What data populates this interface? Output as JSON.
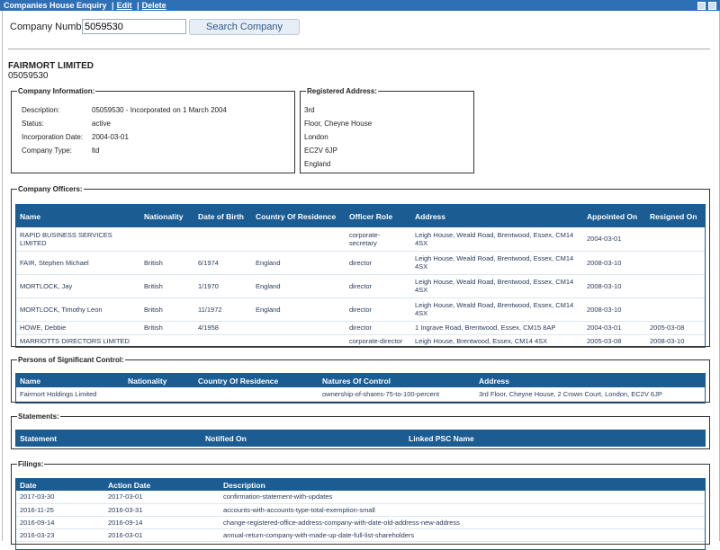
{
  "window": {
    "title": "Companies House Enquiry",
    "sep1": "|",
    "edit": "Edit",
    "sep2": "|",
    "delete": "Delete"
  },
  "search": {
    "label": "Company Number:",
    "value": "5059530",
    "button": "Search Company"
  },
  "company": {
    "name": "FAIRMORT LIMITED",
    "number": "05059530"
  },
  "info": {
    "legend": "Company Information:",
    "rows": [
      {
        "k": "Description:",
        "v": "05059530 - Incorporated on 1 March 2004"
      },
      {
        "k": "Status:",
        "v": "active"
      },
      {
        "k": "Incorporation Date:",
        "v": "2004-03-01"
      },
      {
        "k": "Company Type:",
        "v": "ltd"
      }
    ]
  },
  "address": {
    "legend": "Registered Address:",
    "lines": [
      "3rd",
      "Floor, Cheyne House",
      "London",
      "EC2V 6JP",
      "England"
    ]
  },
  "officers": {
    "legend": "Company Officers:",
    "headers": [
      "Name",
      "Nationality",
      "Date of Birth",
      "Country Of Residence",
      "Officer Role",
      "Address",
      "Appointed On",
      "Resigned On"
    ],
    "rows": [
      [
        "RAPID BUSINESS SERVICES LIMITED",
        "",
        "",
        "",
        "corporate-secretary",
        "Leigh House, Weald Road, Brentwood, Essex, CM14 4SX",
        "2004-03-01",
        ""
      ],
      [
        "FAIR, Stephen Michael",
        "British",
        "6/1974",
        "England",
        "director",
        "Leigh House, Weald Road, Brentwood, Essex, CM14 4SX",
        "2008-03-10",
        ""
      ],
      [
        "MORTLOCK, Jay",
        "British",
        "1/1970",
        "England",
        "director",
        "Leigh House, Weald Road, Brentwood, Essex, CM14 4SX",
        "2008-03-10",
        ""
      ],
      [
        "MORTLOCK, Timothy Leon",
        "British",
        "11/1972",
        "England",
        "director",
        "Leigh House, Weald Road, Brentwood, Essex, CM14 4SX",
        "2008-03-10",
        ""
      ],
      [
        "HOWE, Debbie",
        "British",
        "4/1958",
        "",
        "director",
        "1 Ingrave Road, Brentwood, Essex, CM15 8AP",
        "2004-03-01",
        "2005-03-08"
      ],
      [
        "MARRIOTTS DIRECTORS LIMITED",
        "",
        "",
        "",
        "corporate-director",
        "Leigh House, Brentwood, Essex, CM14 4SX",
        "2005-03-08",
        "2008-03-10"
      ]
    ]
  },
  "psc": {
    "legend": "Persons of Significant Control:",
    "headers": [
      "Name",
      "Nationality",
      "Country Of Residence",
      "Natures Of Control",
      "Address"
    ],
    "rows": [
      [
        "Fairmort Holdings Limited",
        "",
        "",
        "ownership-of-shares-75-to-100-percent",
        "3rd Floor, Cheyne House, 2 Crown Court, London, EC2V 6JP"
      ]
    ]
  },
  "statements": {
    "legend": "Statements:",
    "headers": [
      "Statement",
      "Notified On",
      "Linked PSC Name"
    ]
  },
  "filings": {
    "legend": "Filings:",
    "headers": [
      "Date",
      "Action Date",
      "Description"
    ],
    "rows": [
      [
        "2017-03-30",
        "2017-03-01",
        "confirmation-statement-with-updates"
      ],
      [
        "2016-11-25",
        "2016-03-31",
        "accounts-with-accounts-type-total-exemption-small"
      ],
      [
        "2016-09-14",
        "2016-09-14",
        "change-registered-office-address-company-with-date-old-address-new-address"
      ],
      [
        "2016-03-23",
        "2016-03-01",
        "annual-return-company-with-made-up-date-full-list-shareholders"
      ]
    ]
  }
}
